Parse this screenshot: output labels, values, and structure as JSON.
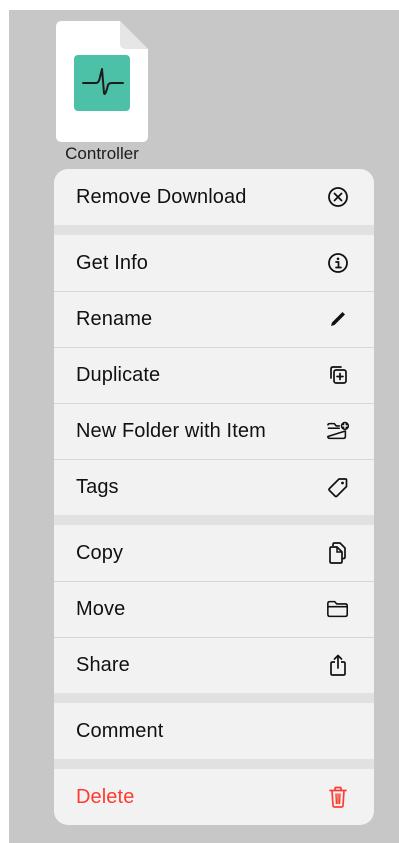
{
  "file": {
    "name": "Controller",
    "icon": "waveform-document-icon",
    "accent_color": "#4dc1a8"
  },
  "menu": {
    "groups": [
      [
        {
          "label": "Remove Download",
          "icon": "x-circle-icon"
        }
      ],
      [
        {
          "label": "Get Info",
          "icon": "info-circle-icon"
        },
        {
          "label": "Rename",
          "icon": "pencil-icon"
        },
        {
          "label": "Duplicate",
          "icon": "duplicate-icon"
        },
        {
          "label": "New Folder with Item",
          "icon": "folder-badge-plus-icon"
        },
        {
          "label": "Tags",
          "icon": "tag-icon"
        }
      ],
      [
        {
          "label": "Copy",
          "icon": "copy-icon"
        },
        {
          "label": "Move",
          "icon": "folder-icon"
        },
        {
          "label": "Share",
          "icon": "share-icon"
        }
      ],
      [
        {
          "label": "Comment",
          "icon": ""
        }
      ],
      [
        {
          "label": "Delete",
          "icon": "trash-icon",
          "destructive": true
        }
      ]
    ]
  },
  "colors": {
    "destructive": "#ff3b30",
    "text": "#111111"
  }
}
